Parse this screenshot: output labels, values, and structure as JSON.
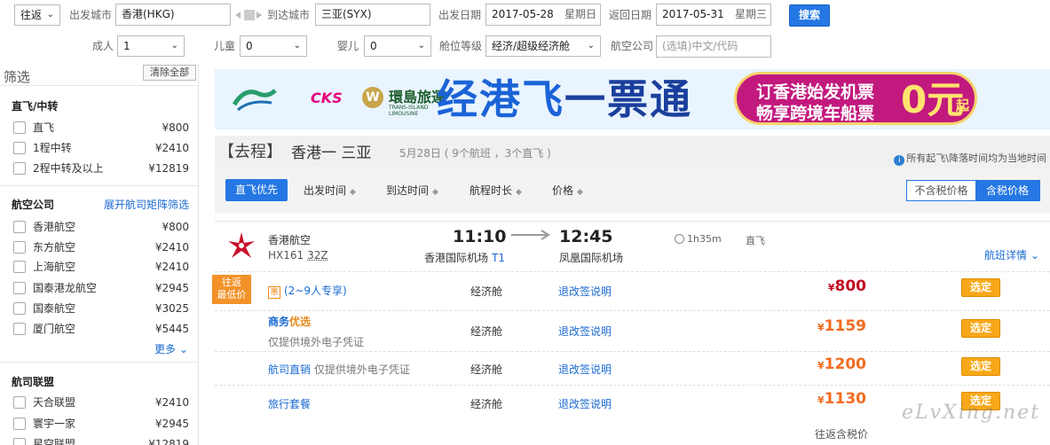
{
  "search": {
    "trip_type": "往返",
    "from_label": "出发城市",
    "from_value": "香港(HKG)",
    "to_label": "到达城市",
    "to_value": "三亚(SYX)",
    "depart_label": "出发日期",
    "depart_date": "2017-05-28",
    "depart_dow": "星期日",
    "return_label": "返回日期",
    "return_date": "2017-05-31",
    "return_dow": "星期三",
    "search_button": "搜索",
    "adult_label": "成人",
    "adult_value": "1",
    "child_label": "儿童",
    "child_value": "0",
    "infant_label": "婴儿",
    "infant_value": "0",
    "cabin_label": "舱位等级",
    "cabin_value": "经济/超级经济舱",
    "airline_label": "航空公司",
    "airline_placeholder": "(选填)中文/代码"
  },
  "sidebar": {
    "title": "筛选",
    "clear_all": "清除全部",
    "stops_title": "直飞/中转",
    "stops": [
      {
        "label": "直飞",
        "price": "¥800"
      },
      {
        "label": "1程中转",
        "price": "¥2410"
      },
      {
        "label": "2程中转及以上",
        "price": "¥12819"
      }
    ],
    "airlines_title": "航空公司",
    "airlines_link": "展开航司矩阵筛选",
    "airlines": [
      {
        "label": "香港航空",
        "price": "¥800"
      },
      {
        "label": "东方航空",
        "price": "¥2410"
      },
      {
        "label": "上海航空",
        "price": "¥2410"
      },
      {
        "label": "国泰港龙航空",
        "price": "¥2945"
      },
      {
        "label": "国泰航空",
        "price": "¥3025"
      },
      {
        "label": "厦门航空",
        "price": "¥5445"
      }
    ],
    "more": "更多",
    "alliance_title": "航司联盟",
    "alliances": [
      {
        "label": "天合联盟",
        "price": "¥2410"
      },
      {
        "label": "寰宇一家",
        "price": "¥2945"
      },
      {
        "label": "星空联盟",
        "price": "¥12819"
      }
    ]
  },
  "banner": {
    "cks": "CKS",
    "w": "W",
    "hrt": "環島旅運",
    "hrt_sub": "TRANS-ISLAND LIMOUSINE",
    "slogan_a": "经港飞",
    "slogan_b": "一票通",
    "pill_line1": "订香港始发机票",
    "pill_line2": "畅享跨境车船票",
    "pill_big": "0元",
    "pill_qi": "起"
  },
  "route": {
    "direction": "【去程】",
    "cities": "香港一 三亚",
    "meta": "5月28日 ( 9个航班 ，3个直飞 )",
    "note": "所有起飞\\降落时间均为当地时间",
    "info_icon": "i"
  },
  "sort": {
    "active": "直飞优先",
    "items": [
      "出发时间",
      "到达时间",
      "航程时长",
      "价格"
    ],
    "tri": "◆",
    "tax_off": "不含税价格",
    "tax_on": "含税价格"
  },
  "flight": {
    "airline": "香港航空",
    "flight_no": "HX161",
    "aircraft": "32Z",
    "dep_time": "11:10",
    "arr_time": "12:45",
    "dep_airport": "香港国际机场",
    "dep_terminal": "T1",
    "arr_airport": "凤凰国际机场",
    "duration": "1h35m",
    "direct": "直飞",
    "detail_link": "航班详情 ⌄",
    "lowest_tag_1": "往返",
    "lowest_tag_2": "最低价",
    "fares": [
      {
        "badge": "惠",
        "desc": "(2~9人专享)",
        "sub": "",
        "cabin": "经济舱",
        "rule": "退改签说明",
        "currency": "¥",
        "price": "800",
        "book": "选定"
      },
      {
        "desc_a": "商务",
        "desc_b": "优选",
        "desc": "",
        "sub": "仅提供境外电子凭证",
        "cabin": "经济舱",
        "rule": "退改签说明",
        "currency": "¥",
        "price": "1159",
        "book": "选定"
      },
      {
        "desc": "航司直销",
        "sub": "仅提供境外电子凭证",
        "cabin": "经济舱",
        "rule": "退改签说明",
        "currency": "¥",
        "price": "1200",
        "book": "选定"
      },
      {
        "desc": "旅行套餐",
        "sub": "",
        "cabin": "经济舱",
        "rule": "退改签说明",
        "currency": "¥",
        "price": "1130",
        "book": "选定"
      }
    ],
    "footer_note": "往返含税价"
  },
  "watermark": "eLvXing.net",
  "colors": {
    "accent_blue": "#2577e3",
    "book_orange": "#f7a818",
    "price_orange": "#f26c20",
    "price_red": "#c30d23",
    "banner_magenta": "#c2197e"
  }
}
